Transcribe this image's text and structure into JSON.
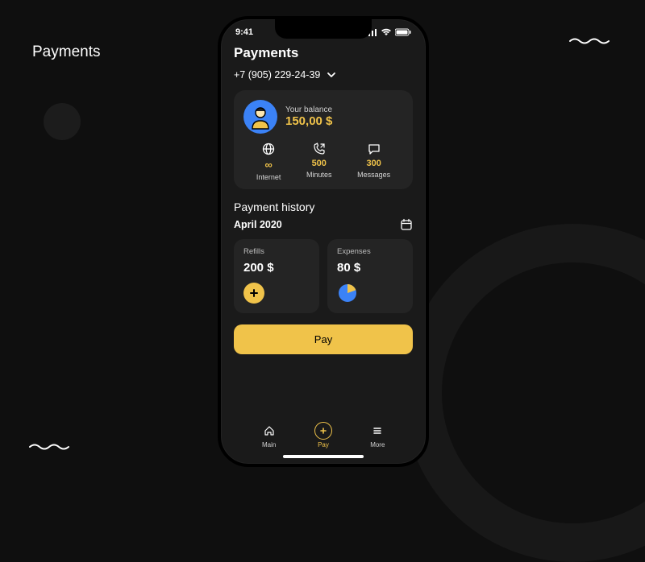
{
  "page": {
    "title": "Payments"
  },
  "status": {
    "time": "9:41"
  },
  "screen": {
    "title": "Payments",
    "phone_number": "+7 (905) 229-24-39"
  },
  "balance": {
    "label": "Your balance",
    "amount": "150,00 $",
    "usage": {
      "internet": {
        "value": "∞",
        "label": "Internet"
      },
      "minutes": {
        "value": "500",
        "label": "Minutes"
      },
      "messages": {
        "value": "300",
        "label": "Messages"
      }
    }
  },
  "history": {
    "title": "Payment history",
    "month": "April 2020",
    "refills": {
      "label": "Refills",
      "value": "200 $"
    },
    "expenses": {
      "label": "Expenses",
      "value": "80 $"
    }
  },
  "actions": {
    "pay": "Pay"
  },
  "tabs": {
    "main": "Main",
    "pay": "Pay",
    "more": "More"
  },
  "colors": {
    "accent": "#f0c34a",
    "blue": "#3b82f6",
    "card": "#242424"
  }
}
